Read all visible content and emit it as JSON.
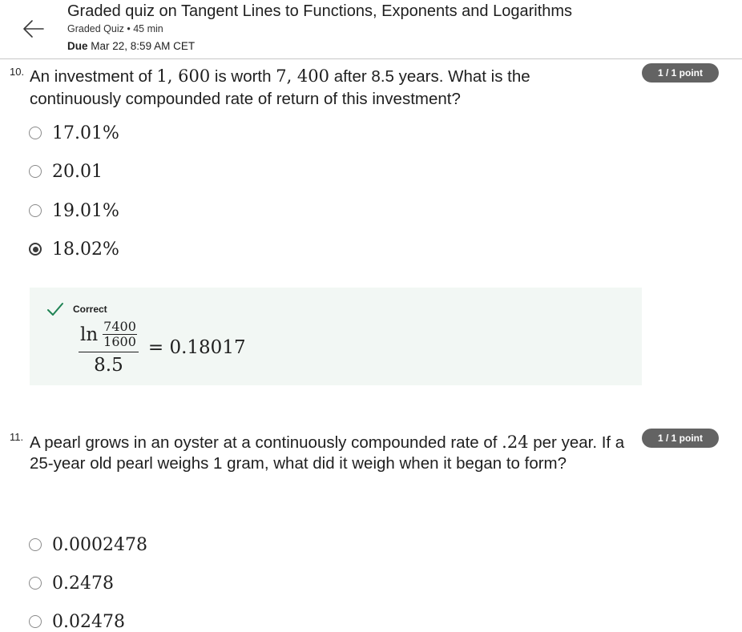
{
  "header": {
    "title": "Graded quiz on Tangent Lines to Functions, Exponents and Logarithms",
    "meta": "Graded Quiz • 45 min",
    "due_label": "Due",
    "due_value": "Mar 22, 8:59 AM CET"
  },
  "questions": [
    {
      "number": "10.",
      "text_parts": [
        "An investment of ",
        "1, 600",
        " is worth ",
        "7, 400",
        " after 8.5 years. What is the continuously compounded rate of return of this investment?"
      ],
      "score": "1 / 1 point",
      "options": [
        {
          "label": "17.01%",
          "selected": false
        },
        {
          "label": "20.01",
          "selected": false
        },
        {
          "label": "19.01%",
          "selected": false
        },
        {
          "label": "18.02%",
          "selected": true
        }
      ],
      "feedback": {
        "status": "Correct",
        "formula": {
          "ln": "ln",
          "inner_numerator": "7400",
          "inner_denominator": "1600",
          "denominator": "8.5",
          "result": "= 0.18017"
        }
      }
    },
    {
      "number": "11.",
      "text_parts": [
        "A pearl grows in an oyster at a continuously compounded rate of ",
        ".24",
        " per year. If a 25-year old pearl weighs 1 gram, what did it weigh when it began to form?"
      ],
      "score": "1 / 1 point",
      "options": [
        {
          "label": "0.0002478",
          "selected": false
        },
        {
          "label": "0.2478",
          "selected": false
        },
        {
          "label": "0.02478",
          "selected": false
        }
      ]
    }
  ],
  "colors": {
    "badge_bg": "#636363",
    "feedback_bg": "#f2f7f4",
    "correct_check": "#1f8354"
  },
  "icons": {
    "back": "arrow-left-icon",
    "correct": "checkmark-icon"
  }
}
